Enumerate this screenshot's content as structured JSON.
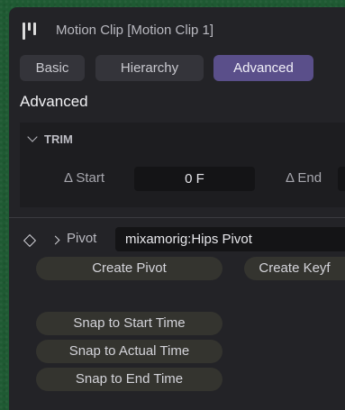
{
  "window": {
    "title": "Motion Clip [Motion Clip 1]",
    "icon": "motion-clip-icon"
  },
  "tabs": [
    {
      "label": "Basic",
      "active": false
    },
    {
      "label": "Hierarchy",
      "active": false
    },
    {
      "label": "Advanced",
      "active": true
    }
  ],
  "section": {
    "title": "Advanced"
  },
  "trim": {
    "header": "TRIM",
    "expanded": true,
    "start_label": "Δ Start",
    "start_value": "0 F",
    "end_label": "Δ End",
    "end_value": ""
  },
  "pivot": {
    "label": "Pivot",
    "expanded": false,
    "value": "mixamorig:Hips Pivot",
    "create_pivot_label": "Create Pivot",
    "create_key_label": "Create Keyf"
  },
  "snap": {
    "start_label": "Snap to Start Time",
    "actual_label": "Snap to Actual Time",
    "end_label": "Snap to End Time"
  },
  "colors": {
    "panel_bg": "#232327",
    "active_tab": "#5a4f8a",
    "desktop": "#1f5a33"
  }
}
